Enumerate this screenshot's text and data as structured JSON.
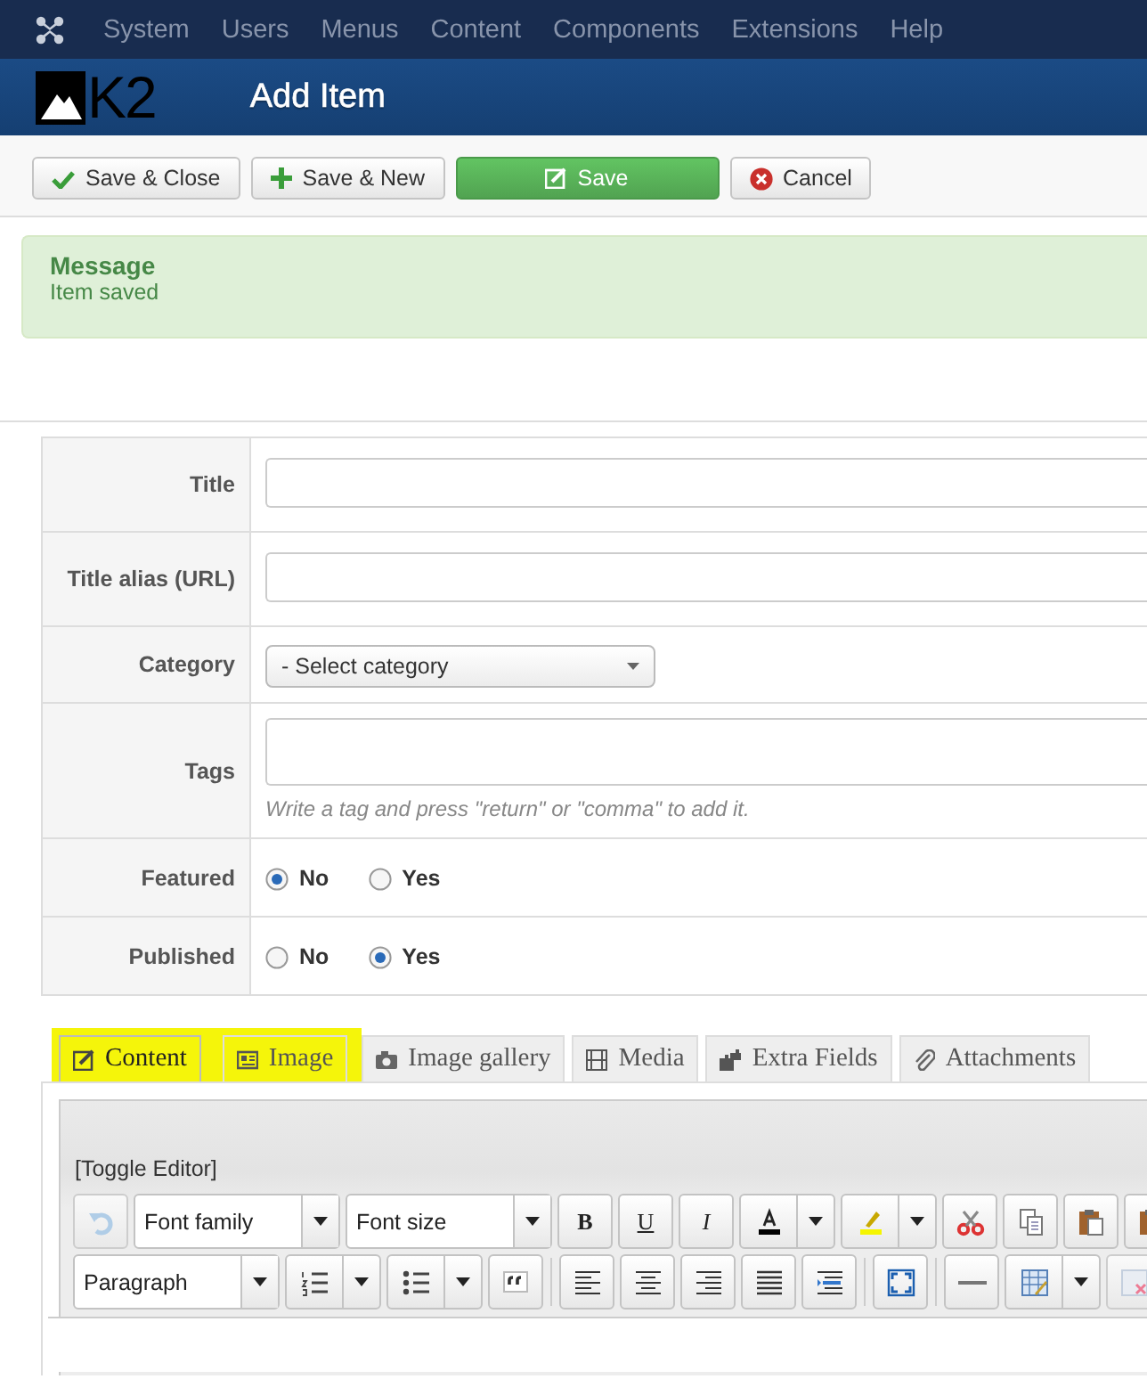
{
  "menu": {
    "items": [
      "System",
      "Users",
      "Menus",
      "Content",
      "Components",
      "Extensions",
      "Help"
    ]
  },
  "header": {
    "logo": "K2",
    "title": "Add Item"
  },
  "toolbar": {
    "buttons": [
      {
        "label": "Save & Close",
        "kind": "check"
      },
      {
        "label": "Save & New",
        "kind": "plus"
      },
      {
        "label": "Save",
        "kind": "primary"
      },
      {
        "label": "Cancel",
        "kind": "cancel"
      }
    ]
  },
  "message": {
    "heading": "Message",
    "text": "Item saved"
  },
  "form": {
    "rows": [
      {
        "label": "Title",
        "kind": "text"
      },
      {
        "label": "Title alias (URL)",
        "kind": "text"
      },
      {
        "label": "Category",
        "kind": "select",
        "value": "- Select category"
      },
      {
        "label": "Tags",
        "kind": "tags",
        "hint": "Write a tag and press \"return\" or \"comma\" to add it."
      },
      {
        "label": "Featured",
        "kind": "radio",
        "options": [
          {
            "label": "No",
            "selected": true
          },
          {
            "label": "Yes",
            "selected": false
          }
        ]
      },
      {
        "label": "Published",
        "kind": "radio",
        "options": [
          {
            "label": "No",
            "selected": false
          },
          {
            "label": "Yes",
            "selected": true
          }
        ]
      }
    ]
  },
  "tabs": [
    {
      "label": "Content",
      "kind": "edit",
      "selected": true,
      "highlighted": true
    },
    {
      "label": "Image",
      "kind": "image",
      "selected": false,
      "highlighted": true
    },
    {
      "label": "Image gallery",
      "kind": "camera",
      "selected": false,
      "highlighted": false
    },
    {
      "label": "Media",
      "kind": "film",
      "selected": false,
      "highlighted": false
    },
    {
      "label": "Extra Fields",
      "kind": "puzzle",
      "selected": false,
      "highlighted": false
    },
    {
      "label": "Attachments",
      "kind": "clip",
      "selected": false,
      "highlighted": false
    }
  ],
  "editor": {
    "toggle": "[Toggle Editor]",
    "rows": [
      [
        {
          "kind": "undo",
          "disabled": true
        },
        {
          "kind": "select",
          "label": "Font family"
        },
        {
          "kind": "select",
          "label": "Font size"
        },
        {
          "kind": "bold",
          "label": "B"
        },
        {
          "kind": "underline",
          "label": "U"
        },
        {
          "kind": "italic",
          "label": "I"
        },
        {
          "kind": "text-color"
        },
        {
          "kind": "highlight"
        },
        {
          "kind": "cut"
        },
        {
          "kind": "copy"
        },
        {
          "kind": "paste"
        },
        {
          "kind": "paste-text"
        }
      ],
      [
        {
          "kind": "select",
          "label": "Paragraph"
        },
        {
          "kind": "ordered-list"
        },
        {
          "kind": "bullet-list"
        },
        {
          "kind": "quote"
        },
        {
          "kind": "sep"
        },
        {
          "kind": "align-left"
        },
        {
          "kind": "align-center"
        },
        {
          "kind": "align-right"
        },
        {
          "kind": "justify"
        },
        {
          "kind": "indent"
        },
        {
          "kind": "sep"
        },
        {
          "kind": "fullscreen"
        },
        {
          "kind": "sep"
        },
        {
          "kind": "rule"
        },
        {
          "kind": "table"
        },
        {
          "kind": "delete-table"
        }
      ]
    ]
  }
}
